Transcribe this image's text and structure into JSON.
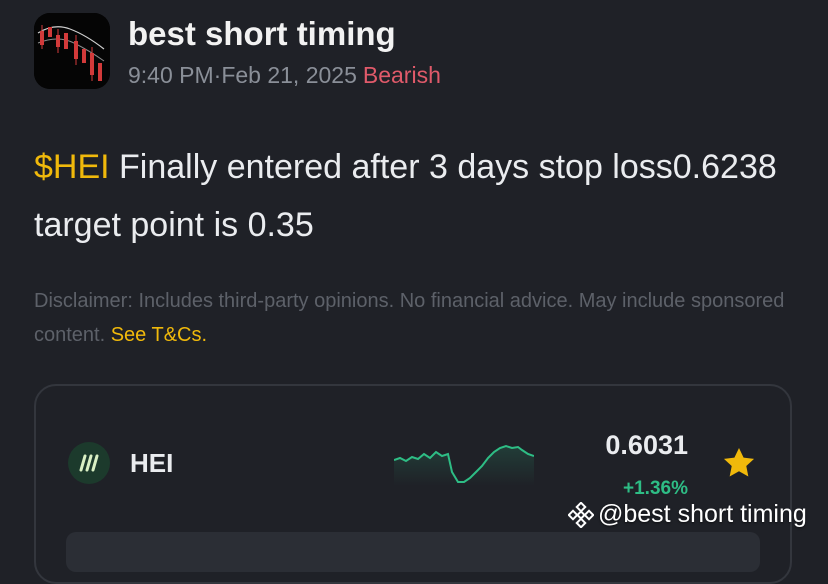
{
  "post": {
    "author": "best short timing",
    "time": "9:40 PM·Feb 21, 2025",
    "sentiment": "Bearish",
    "ticker": "$HEI",
    "text": " Finally entered after 3 days stop loss0.6238 target point is 0.35",
    "avatar_icon": "candlestick-chart-avatar"
  },
  "disclaimer": {
    "text": "Disclaimer: Includes third-party opinions. No financial advice. May include sponsored content. ",
    "link": "See T&Cs."
  },
  "coin_card": {
    "name": "HEI",
    "price": "0.6031",
    "change": "+1.36%",
    "logo_icon": "hei-logo-icon",
    "favorite_icon": "star-icon",
    "sparkline_color": "#2ebd85"
  },
  "watermark": {
    "text": "@best short timing",
    "icon": "binance-logo-icon"
  },
  "colors": {
    "background": "#1f2127",
    "accent": "#f0b90b",
    "bearish": "#e05a6a",
    "positive": "#2ebd85"
  }
}
